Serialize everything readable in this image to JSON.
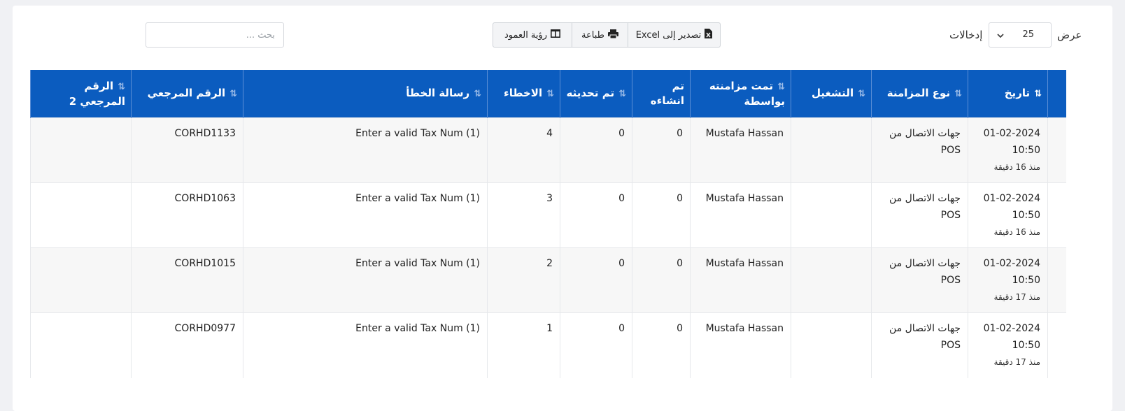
{
  "length_control": {
    "show_label": "عرض",
    "value": "25",
    "entries_label": "إدخالات"
  },
  "buttons": {
    "excel": "تصدير إلى Excel",
    "print": "طباعة",
    "columns": "رؤية العمود"
  },
  "search": {
    "placeholder": "بحث ..."
  },
  "columns": {
    "date": "تاريخ",
    "sync_type": "نوع المزامنة",
    "run": "التشغيل",
    "synced_by": "تمت مزامنته بواسطة",
    "created": "تم انشاءه",
    "updated": "تم تحديثه",
    "errors": "الاخطاء",
    "error_message": "رسالة الخطأ",
    "reference": "الرقم المرجعي",
    "reference2": "الرقم المرجعي 2"
  },
  "rows": [
    {
      "date": "01-02-2024",
      "time": "10:50",
      "ago": "منذ 16 دقيقة",
      "sync_type": "جهات الاتصال من POS",
      "run": "",
      "synced_by": "Mustafa Hassan",
      "created": "0",
      "updated": "0",
      "errors": "4",
      "error_message": "Enter a valid Tax Num (1)",
      "reference": "CORHD1133",
      "reference2": ""
    },
    {
      "date": "01-02-2024",
      "time": "10:50",
      "ago": "منذ 16 دقيقة",
      "sync_type": "جهات الاتصال من POS",
      "run": "",
      "synced_by": "Mustafa Hassan",
      "created": "0",
      "updated": "0",
      "errors": "3",
      "error_message": "Enter a valid Tax Num (1)",
      "reference": "CORHD1063",
      "reference2": ""
    },
    {
      "date": "01-02-2024",
      "time": "10:50",
      "ago": "منذ 17 دقيقة",
      "sync_type": "جهات الاتصال من POS",
      "run": "",
      "synced_by": "Mustafa Hassan",
      "created": "0",
      "updated": "0",
      "errors": "2",
      "error_message": "Enter a valid Tax Num (1)",
      "reference": "CORHD1015",
      "reference2": ""
    },
    {
      "date": "01-02-2024",
      "time": "10:50",
      "ago": "منذ 17 دقيقة",
      "sync_type": "جهات الاتصال من POS",
      "run": "",
      "synced_by": "Mustafa Hassan",
      "created": "0",
      "updated": "0",
      "errors": "1",
      "error_message": "Enter a valid Tax Num (1)",
      "reference": "CORHD0977",
      "reference2": ""
    }
  ],
  "colors": {
    "header_bg": "#0b5cbf",
    "row_alt": "#f7f7f7"
  },
  "icons": {
    "excel": "file-excel-icon",
    "print": "printer-icon",
    "columns": "columns-icon",
    "sort": "sort-icon",
    "dropdown": "chevron-down-icon"
  }
}
